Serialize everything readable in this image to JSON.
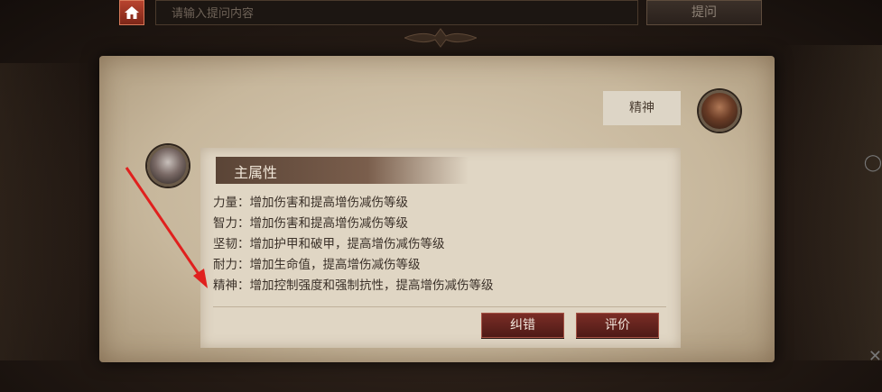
{
  "topbar": {
    "search_placeholder": "请输入提问内容",
    "ask_label": "提问"
  },
  "question": {
    "text": "精神"
  },
  "answer": {
    "header": "主属性",
    "lines": [
      "力量：增加伤害和提高增伤减伤等级",
      "智力：增加伤害和提高增伤减伤等级",
      "坚韧：增加护甲和破甲，提高增伤减伤等级",
      "耐力：增加生命值，提高增伤减伤等级",
      "精神：增加控制强度和强制抗性，提高增伤减伤等级"
    ],
    "correct_label": "纠错",
    "rate_label": "评价"
  },
  "icons": {
    "home": "home-icon",
    "arrow_annotation": "red-arrow-annotation"
  },
  "colors": {
    "accent_red": "#7a2d26",
    "parchment": "#e0d6c4",
    "home_button": "#b8432e"
  }
}
